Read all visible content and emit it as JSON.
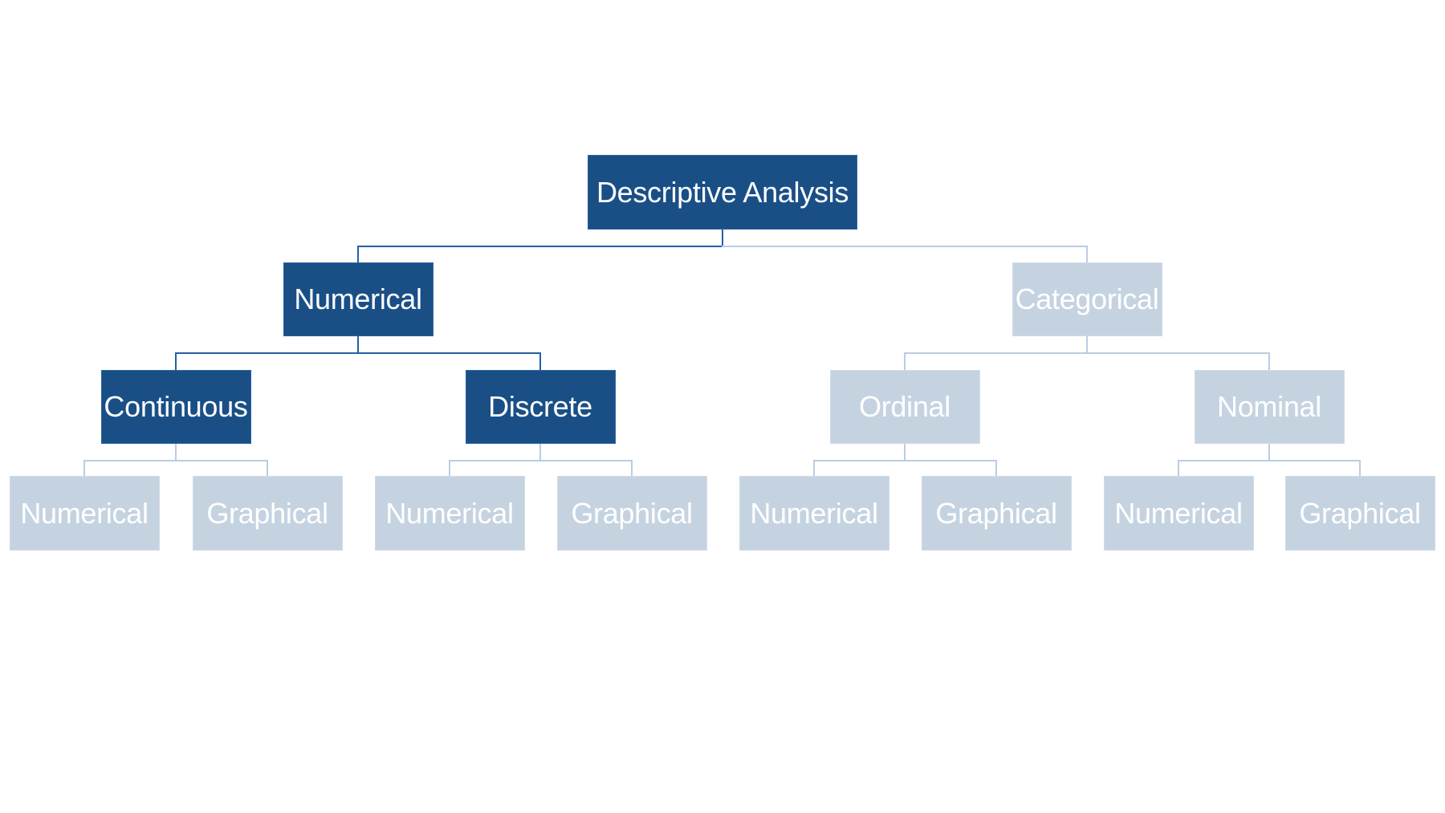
{
  "diagram": {
    "title": "Descriptive Analysis",
    "colors": {
      "active_box": "#1a4f86",
      "inactive_box": "#c5d3e1",
      "active_line": "#2460a6",
      "inactive_line": "#b9cde3",
      "text": "#ffffff"
    },
    "root": {
      "label": "Descriptive Analysis",
      "active": true,
      "children": [
        {
          "label": "Numerical",
          "active": true,
          "children": [
            {
              "label": "Continuous",
              "active": true,
              "children": [
                {
                  "label": "Numerical",
                  "active": false
                },
                {
                  "label": "Graphical",
                  "active": false
                }
              ]
            },
            {
              "label": "Discrete",
              "active": true,
              "children": [
                {
                  "label": "Numerical",
                  "active": false
                },
                {
                  "label": "Graphical",
                  "active": false
                }
              ]
            }
          ]
        },
        {
          "label": "Categorical",
          "active": false,
          "children": [
            {
              "label": "Ordinal",
              "active": false,
              "children": [
                {
                  "label": "Numerical",
                  "active": false
                },
                {
                  "label": "Graphical",
                  "active": false
                }
              ]
            },
            {
              "label": "Nominal",
              "active": false,
              "children": [
                {
                  "label": "Numerical",
                  "active": false
                },
                {
                  "label": "Graphical",
                  "active": false
                }
              ]
            }
          ]
        }
      ]
    }
  }
}
